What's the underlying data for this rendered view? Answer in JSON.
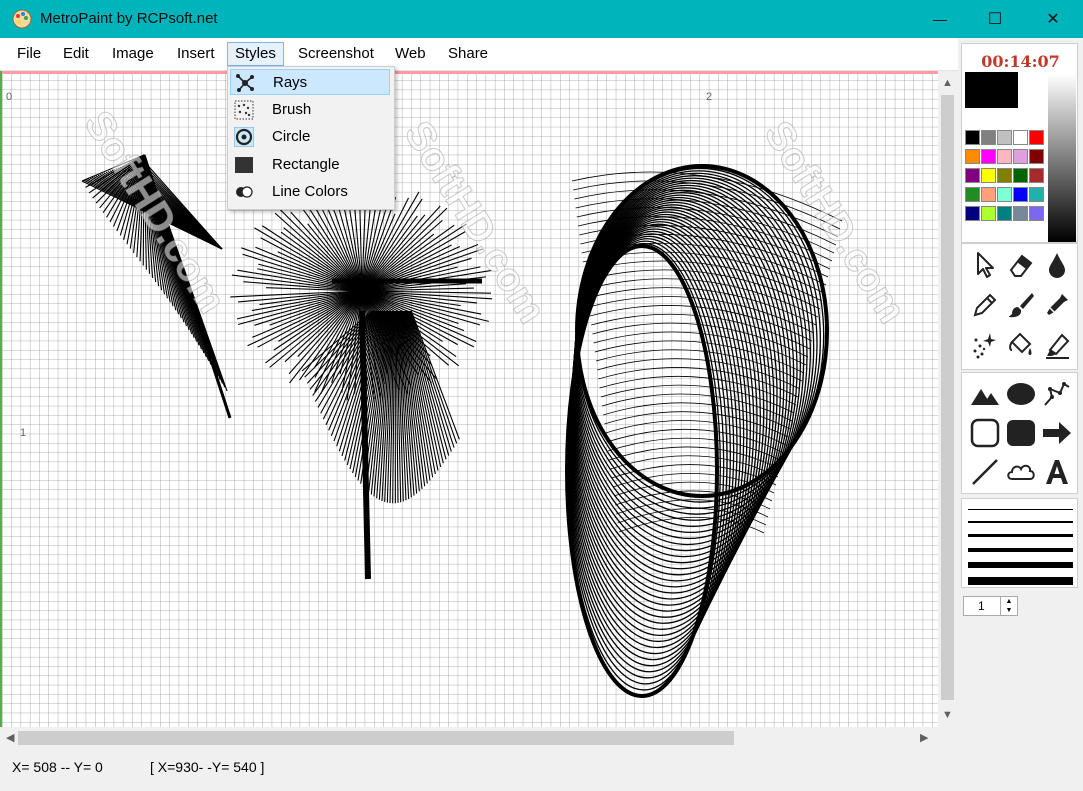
{
  "window": {
    "title": "MetroPaint by RCPsoft.net",
    "controls": {
      "minimize": "—",
      "maximize": "☐",
      "close": "✕"
    }
  },
  "menu": {
    "items": [
      {
        "label": "File"
      },
      {
        "label": "Edit"
      },
      {
        "label": "Image"
      },
      {
        "label": "Insert"
      },
      {
        "label": "Styles",
        "active": true
      },
      {
        "label": "Screenshot"
      },
      {
        "label": "Web"
      },
      {
        "label": "Share"
      }
    ]
  },
  "styles_menu": {
    "items": [
      {
        "label": "Rays",
        "icon": "rays-icon",
        "highlighted": true
      },
      {
        "label": "Brush",
        "icon": "brush-dots-icon"
      },
      {
        "label": "Circle",
        "icon": "circle-target-icon"
      },
      {
        "label": "Rectangle",
        "icon": "rectangle-icon"
      },
      {
        "label": "Line Colors",
        "icon": "toggle-circles-icon"
      }
    ]
  },
  "ruler": {
    "marks": [
      "0",
      "2",
      "1"
    ]
  },
  "panel": {
    "timer": "00:14:07",
    "primary_color": "#000000",
    "secondary_color": "#ffffff",
    "palette": [
      [
        "#000000",
        "#808080",
        "#c0c0c0",
        "#ffffff",
        "#ff0000"
      ],
      [
        "#ff8c00",
        "#ff00ff",
        "#ffb6c1",
        "#dda0dd",
        "#800000"
      ],
      [
        "#800080",
        "#ffff00",
        "#808000",
        "#006400",
        "#a52a2a"
      ],
      [
        "#228b22",
        "#ffa07a",
        "#7fffd4",
        "#0000ff",
        "#20b2aa"
      ],
      [
        "#000080",
        "#adff2f",
        "#008080",
        "#778899",
        "#7b68ee"
      ]
    ],
    "tools": [
      "pointer-icon",
      "eraser-icon",
      "drop-icon",
      "pencil-icon",
      "brush-icon",
      "dropper-icon",
      "spray-icon",
      "fill-bucket-icon",
      "highlighter-icon"
    ],
    "shapes": [
      "triangles-icon",
      "ellipse-icon",
      "polyline-icon",
      "rounded-square-outline-icon",
      "rounded-square-filled-icon",
      "arrow-right-icon",
      "line-icon",
      "cloud-icon",
      "text-icon"
    ],
    "line_width": "1"
  },
  "status": {
    "cursor": "X= 508 --  Y= 0",
    "size": "[ X=930- -Y= 540 ]"
  },
  "watermark": "SoftHD.com"
}
